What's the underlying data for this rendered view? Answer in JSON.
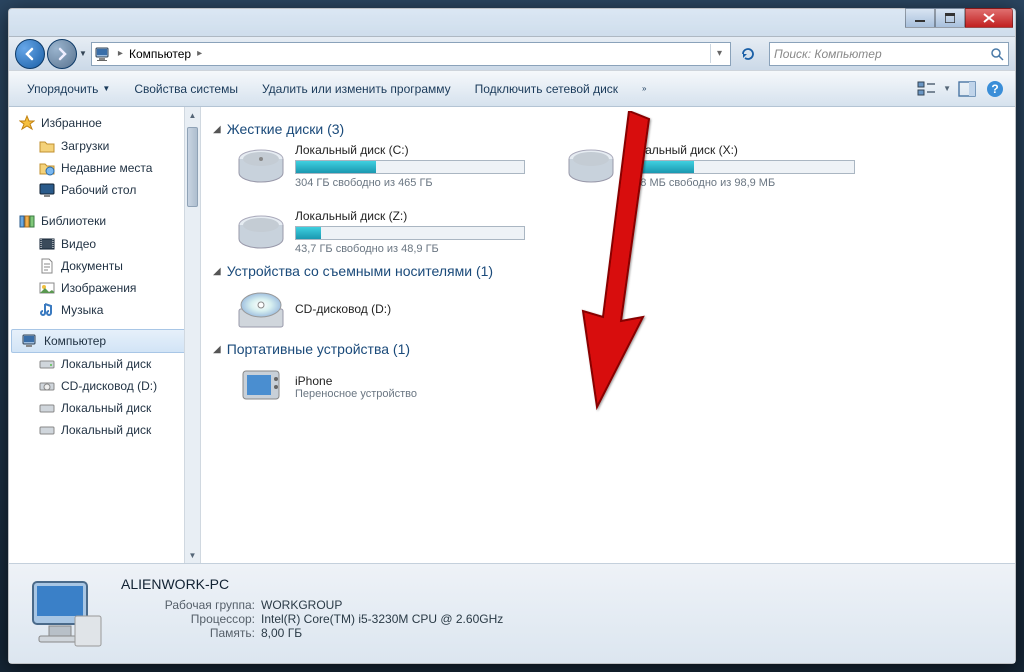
{
  "breadcrumb": {
    "root": "Компьютер"
  },
  "search": {
    "placeholder": "Поиск: Компьютер"
  },
  "toolbar": {
    "organize": "Упорядочить",
    "sysprops": "Свойства системы",
    "uninstall": "Удалить или изменить программу",
    "mapdrive": "Подключить сетевой диск"
  },
  "sidebar": {
    "favorites": {
      "title": "Избранное",
      "downloads": "Загрузки",
      "recent": "Недавние места",
      "desktop": "Рабочий стол"
    },
    "libraries": {
      "title": "Библиотеки",
      "video": "Видео",
      "docs": "Документы",
      "pictures": "Изображения",
      "music": "Музыка"
    },
    "computer": {
      "title": "Компьютер",
      "d1": "Локальный диск",
      "d2": "CD-дисковод (D:)",
      "d3": "Локальный диск",
      "d4": "Локальный диск"
    }
  },
  "groups": {
    "hdd": "Жесткие диски (3)",
    "removable": "Устройства со съемными носителями (1)",
    "portable": "Портативные устройства (1)"
  },
  "drives": {
    "c": {
      "name": "Локальный диск (C:)",
      "free": "304 ГБ свободно из 465 ГБ",
      "pct": 35
    },
    "x": {
      "name": "Локальный диск (X:)",
      "free": "69,8 МБ свободно из 98,9 МБ",
      "pct": 30
    },
    "z": {
      "name": "Локальный диск (Z:)",
      "free": "43,7 ГБ свободно из 48,9 ГБ",
      "pct": 11
    },
    "d": {
      "name": "CD-дисковод (D:)"
    }
  },
  "portable": {
    "iphone": {
      "name": "iPhone",
      "sub": "Переносное устройство"
    }
  },
  "details": {
    "name": "ALIENWORK-PC",
    "workgroup_k": "Рабочая группа:",
    "workgroup_v": "WORKGROUP",
    "cpu_k": "Процессор:",
    "cpu_v": "Intel(R) Core(TM) i5-3230M CPU @ 2.60GHz",
    "ram_k": "Память:",
    "ram_v": "8,00 ГБ"
  }
}
